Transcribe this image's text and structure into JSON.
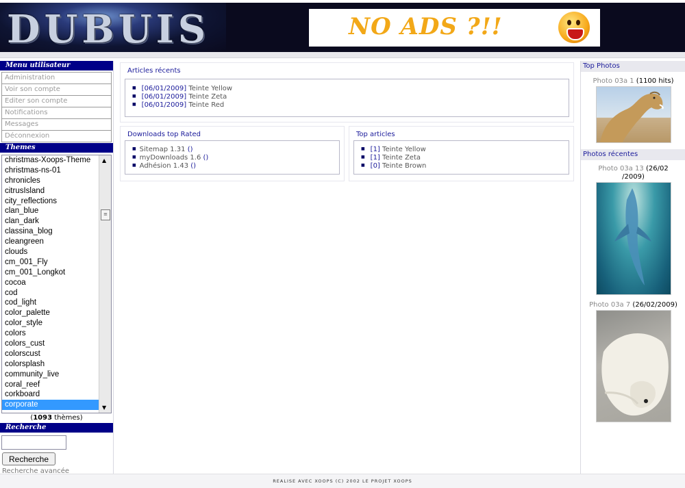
{
  "header": {
    "logo_text": "DUBUIS",
    "ad_text": "NO ADS ?!!"
  },
  "user_menu": {
    "title": "Menu utilisateur",
    "items": [
      "Administration",
      "Voir son compte",
      "Editer son compte",
      "Notifications",
      "Messages",
      "Déconnexion"
    ]
  },
  "themes": {
    "title": "Themes",
    "options": [
      "christmas-Xoops-Theme",
      "christmas-ns-01",
      "chronicles",
      "citrusIsland",
      "city_reflections",
      "clan_blue",
      "clan_dark",
      "classina_blog",
      "cleangreen",
      "clouds",
      "cm_001_Fly",
      "cm_001_Longkot",
      "cocoa",
      "cod",
      "cod_light",
      "color_palette",
      "color_style",
      "colors",
      "colors_cust",
      "colorscust",
      "colorsplash",
      "community_live",
      "coral_reef",
      "corkboard",
      "corporate"
    ],
    "selected": "corporate",
    "count_prefix": "(",
    "count": "1093",
    "count_suffix": " thèmes)"
  },
  "search": {
    "title": "Recherche",
    "input_value": "",
    "button_label": "Recherche",
    "advanced_link": "Recherche avancée"
  },
  "articles_recents": {
    "title": "Articles récents",
    "items": [
      {
        "date": "[06/01/2009]",
        "title": "Teinte Yellow"
      },
      {
        "date": "[06/01/2009]",
        "title": "Teinte Zeta"
      },
      {
        "date": "[06/01/2009]",
        "title": "Teinte Red"
      }
    ]
  },
  "downloads": {
    "title": "Downloads top Rated",
    "items": [
      {
        "name": "Sitemap 1.31",
        "count": "()"
      },
      {
        "name": "myDownloads 1.6",
        "count": "()"
      },
      {
        "name": "Adhésion 1.43",
        "count": "()"
      }
    ]
  },
  "top_articles": {
    "title": "Top articles",
    "items": [
      {
        "count": "[1]",
        "title": "Teinte Yellow"
      },
      {
        "count": "[1]",
        "title": "Teinte Zeta"
      },
      {
        "count": "[0]",
        "title": "Teinte Brown"
      }
    ]
  },
  "top_photos": {
    "title": "Top Photos",
    "items": [
      {
        "name": "Photo 03a 1",
        "info": " (1100 hits)",
        "icon": "camel-photo"
      }
    ]
  },
  "recent_photos": {
    "title": "Photos récentes",
    "items": [
      {
        "name": "Photo 03a 13",
        "info_line1": " (26/02",
        "info_line2": "/2009)",
        "icon": "dolphin-photo"
      },
      {
        "name": "Photo 03a 7",
        "info": " (26/02/2009)",
        "icon": "polar-bear-photo"
      }
    ]
  },
  "footer": {
    "text": "REALISE AVEC XOOPS (C) 2002  LE PROJET XOOPS"
  },
  "colors": {
    "header_bg": "#0a0a1e",
    "block_title_bg": "#000088",
    "link": "#1a1a9a",
    "select_highlight": "#3399ff",
    "ad_text": "#f2a818"
  }
}
